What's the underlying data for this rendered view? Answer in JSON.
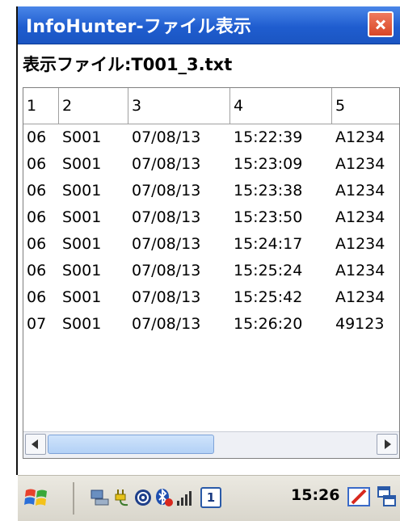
{
  "window": {
    "title": "InfoHunter-ファイル表示",
    "file_label": "表示ファイル:T001_3.txt"
  },
  "table": {
    "headers": [
      "1",
      "2",
      "3",
      "4",
      "5"
    ],
    "rows": [
      [
        "06",
        "S001",
        "07/08/13",
        "15:22:39",
        "A1234"
      ],
      [
        "06",
        "S001",
        "07/08/13",
        "15:23:09",
        "A1234"
      ],
      [
        "06",
        "S001",
        "07/08/13",
        "15:23:38",
        "A1234"
      ],
      [
        "06",
        "S001",
        "07/08/13",
        "15:23:50",
        "A1234"
      ],
      [
        "06",
        "S001",
        "07/08/13",
        "15:24:17",
        "A1234"
      ],
      [
        "06",
        "S001",
        "07/08/13",
        "15:25:24",
        "A1234"
      ],
      [
        "06",
        "S001",
        "07/08/13",
        "15:25:42",
        "A1234"
      ],
      [
        "07",
        "S001",
        "07/08/13",
        "15:26:20",
        "49123"
      ]
    ]
  },
  "taskbar": {
    "clock": "15:26",
    "desktop_number": "1",
    "icons": [
      "windows-start-icon",
      "network-pc-icon",
      "power-plug-icon",
      "wifi-icon",
      "bluetooth-off-icon",
      "signal-icon",
      "desktop-1-icon",
      "edit-pen-icon",
      "window-switch-icon"
    ]
  },
  "colors": {
    "titlebar": "#1f5dcf",
    "close_button": "#d84626",
    "scroll_thumb": "#b3d1f6"
  }
}
